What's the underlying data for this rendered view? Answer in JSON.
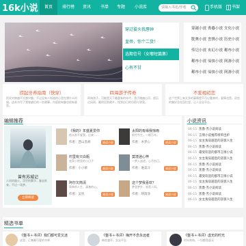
{
  "header": {
    "logo": "16k小说",
    "nav": [
      "首页",
      "排行榜",
      "资讯",
      "书单",
      "专题",
      "小说库"
    ],
    "search_placeholder": "请输入书名/作者",
    "mobile_label": "手机版",
    "shelf_label": "书架"
  },
  "banner": {
    "side_items": [
      "穿过雾头我唇钟",
      "皇帝，你个二货！",
      "选期信号（女嘟短篇集）",
      "心有不甘"
    ],
    "active_index": 2
  },
  "right_box": {
    "rows": [
      [
        "穿越小说",
        "青春小说",
        "文化小说"
      ],
      [
        "耽美小说",
        "言情小说",
        "历史小说"
      ],
      [
        "传记小说",
        "玄幻小说",
        "都市小说"
      ],
      [
        "都市小说",
        "仙侠小说",
        "网游小说"
      ],
      [
        "都市小说",
        "仙侠小说",
        "网游小说"
      ]
    ]
  },
  "promos": [
    {
      "title": "捞起牙养指南（快穿）",
      "desc": "阿呆对穿越不太感兴趣，不过没有人知道他心里在想什么时候。这本书写了我穿越后的一些故事，内容很有趣也很有意思。"
    },
    {
      "title": "四海游子传奇",
      "desc": "四海游子，可能是天下最富有的年代，游子踏遍山河，经历过风雨，最终回到故乡，找到自己的归宿与答案。"
    },
    {
      "title": "不爱相初恋",
      "desc": "这个世界上有太多的事情是不可以重来的，爱情也是。初恋的美好总在回忆里，让人念念不忘。"
    }
  ],
  "editor_section": {
    "title": "编辑推荐",
    "featured": {
      "name": "曾有苏城记",
      "desc": "人间的烟火，浮世的繁华，春去秋来，不过一场梦。",
      "button": "立即阅读"
    },
    "cards": [
      {
        "title": "《我的》年盛夏爱你",
        "desc": "他从前不爱我，后来……",
        "author": "作者：西山黑胡",
        "button": "阅读小说"
      },
      {
        "title": "太阳的有缘我惊雨",
        "desc": "前世今生，一眼万年。",
        "author": "作者：木梦心",
        "button": "阅读小说"
      },
      {
        "title": "村里有只白瓶",
        "desc": "农家小院里的小日子",
        "author": "作者：小小黎",
        "button": "阅读小说"
      },
      {
        "title": "莫境迷心梓",
        "desc": "一梦入迷途，心不由己。",
        "author": "作者：谁美冷",
        "button": "阅读小说"
      },
      {
        "title": "阿尔欠简清",
        "desc": "简单的人生，清澈的心。",
        "author": "作者：吴忧",
        "button": "阅读小说"
      },
      {
        "title": "这个梦我喜欢？",
        "desc": "梦里梦外，皆是人间。",
        "author": "作者：晴雨涂",
        "button": "阅读小说"
      }
    ]
  },
  "news_section": {
    "title": "小说资讯",
    "items": [
      {
        "date": "06-15",
        "text": "凯鲁·杰小说阅读"
      },
      {
        "date": "06-15",
        "text": "言情小说推荐榜单出炉"
      },
      {
        "date": "06-15",
        "text": "女主角穿越后的逆袭人生"
      },
      {
        "date": "06-15",
        "text": "凯鲁·杰小说阅读"
      },
      {
        "date": "06-15",
        "text": "最受欢迎的都市言情小说"
      },
      {
        "date": "06-15",
        "text": "女主角穿越后的逆袭人生"
      },
      {
        "date": "06-15",
        "text": "凯鲁·杰小说阅读"
      },
      {
        "date": "06-15",
        "text": "凯鲁·杰小说阅读"
      },
      {
        "date": "06-15",
        "text": "最受欢迎的都市言情小说"
      },
      {
        "date": "06-15",
        "text": "女主角穿越后的逆袭人生"
      },
      {
        "date": "06-15",
        "text": "凯鲁·杰小说阅读"
      },
      {
        "date": "06-15",
        "text": "凯鲁·杰小说阅读"
      },
      {
        "date": "06-15",
        "text": "女主角穿越后的逆袭人生"
      }
    ]
  },
  "bottom_section": {
    "title": "精选书单",
    "cards": [
      {
        "title": "《整书＋书评》我们都可爱又迷",
        "desc": "这里，汇集最可爱的书单"
      },
      {
        "title": "《整书＋书评》梅开不念永远者",
        "desc": "梅花盛开，念念不忘"
      },
      {
        "title": "《整书＋书评》虚无的时光",
        "desc": "时光匆匆，一切都是虚无"
      }
    ]
  },
  "colors": {
    "accent": "#12b3a0",
    "orange": "#f08844",
    "promo_title": "#e05e3b"
  }
}
